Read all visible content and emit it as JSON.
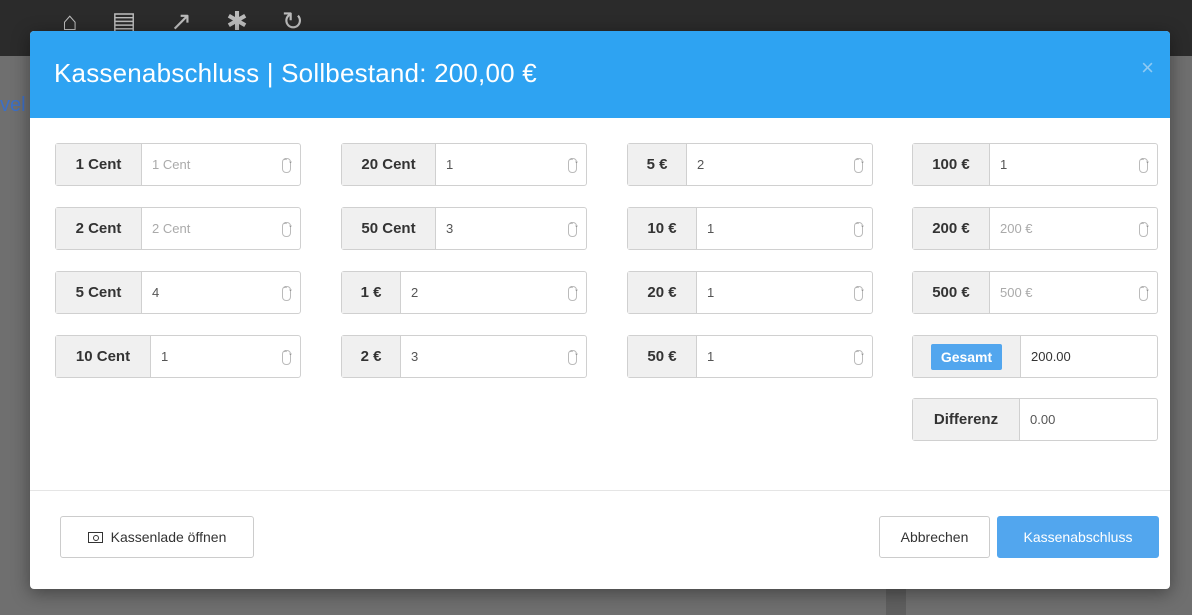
{
  "modal": {
    "title": "Kassenabschluss  |  Sollbestand: 200,00 €",
    "close": "×"
  },
  "denominations": [
    {
      "label": "1 Cent",
      "value": "",
      "placeholder": "1 Cent"
    },
    {
      "label": "2 Cent",
      "value": "",
      "placeholder": "2 Cent"
    },
    {
      "label": "5 Cent",
      "value": "4",
      "placeholder": ""
    },
    {
      "label": "10 Cent",
      "value": "1",
      "placeholder": ""
    },
    {
      "label": "20 Cent",
      "value": "1",
      "placeholder": ""
    },
    {
      "label": "50 Cent",
      "value": "3",
      "placeholder": ""
    },
    {
      "label": "1 €",
      "value": "2",
      "placeholder": ""
    },
    {
      "label": "2 €",
      "value": "3",
      "placeholder": ""
    },
    {
      "label": "5 €",
      "value": "2",
      "placeholder": ""
    },
    {
      "label": "10 €",
      "value": "1",
      "placeholder": ""
    },
    {
      "label": "20 €",
      "value": "1",
      "placeholder": ""
    },
    {
      "label": "50 €",
      "value": "1",
      "placeholder": ""
    },
    {
      "label": "100 €",
      "value": "1",
      "placeholder": ""
    },
    {
      "label": "200 €",
      "value": "",
      "placeholder": "200 €"
    },
    {
      "label": "500 €",
      "value": "",
      "placeholder": "500 €"
    }
  ],
  "total": {
    "label": "Gesamt",
    "value": "200.00"
  },
  "difference": {
    "label": "Differenz",
    "value": "0.00"
  },
  "footer": {
    "open_drawer": "Kassenlade öffnen",
    "cancel": "Abbrechen",
    "submit": "Kassenabschluss"
  },
  "background": {
    "link_fragment": "vel"
  },
  "colors": {
    "header": "#2ea3f2",
    "primary_button": "#52a6ee",
    "difference_text": "#5cb85c"
  }
}
